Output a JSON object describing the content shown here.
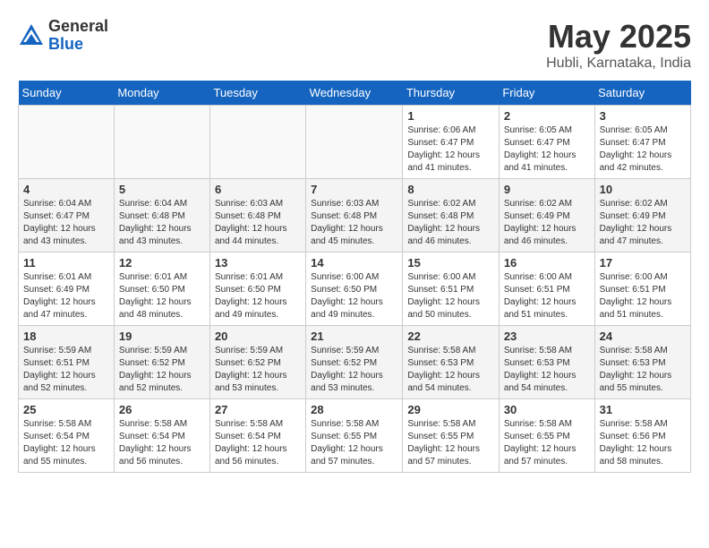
{
  "header": {
    "logo_general": "General",
    "logo_blue": "Blue",
    "title": "May 2025",
    "subtitle": "Hubli, Karnataka, India"
  },
  "days_of_week": [
    "Sunday",
    "Monday",
    "Tuesday",
    "Wednesday",
    "Thursday",
    "Friday",
    "Saturday"
  ],
  "weeks": [
    [
      {
        "day": "",
        "info": ""
      },
      {
        "day": "",
        "info": ""
      },
      {
        "day": "",
        "info": ""
      },
      {
        "day": "",
        "info": ""
      },
      {
        "day": "1",
        "info": "Sunrise: 6:06 AM\nSunset: 6:47 PM\nDaylight: 12 hours\nand 41 minutes."
      },
      {
        "day": "2",
        "info": "Sunrise: 6:05 AM\nSunset: 6:47 PM\nDaylight: 12 hours\nand 41 minutes."
      },
      {
        "day": "3",
        "info": "Sunrise: 6:05 AM\nSunset: 6:47 PM\nDaylight: 12 hours\nand 42 minutes."
      }
    ],
    [
      {
        "day": "4",
        "info": "Sunrise: 6:04 AM\nSunset: 6:47 PM\nDaylight: 12 hours\nand 43 minutes."
      },
      {
        "day": "5",
        "info": "Sunrise: 6:04 AM\nSunset: 6:48 PM\nDaylight: 12 hours\nand 43 minutes."
      },
      {
        "day": "6",
        "info": "Sunrise: 6:03 AM\nSunset: 6:48 PM\nDaylight: 12 hours\nand 44 minutes."
      },
      {
        "day": "7",
        "info": "Sunrise: 6:03 AM\nSunset: 6:48 PM\nDaylight: 12 hours\nand 45 minutes."
      },
      {
        "day": "8",
        "info": "Sunrise: 6:02 AM\nSunset: 6:48 PM\nDaylight: 12 hours\nand 46 minutes."
      },
      {
        "day": "9",
        "info": "Sunrise: 6:02 AM\nSunset: 6:49 PM\nDaylight: 12 hours\nand 46 minutes."
      },
      {
        "day": "10",
        "info": "Sunrise: 6:02 AM\nSunset: 6:49 PM\nDaylight: 12 hours\nand 47 minutes."
      }
    ],
    [
      {
        "day": "11",
        "info": "Sunrise: 6:01 AM\nSunset: 6:49 PM\nDaylight: 12 hours\nand 47 minutes."
      },
      {
        "day": "12",
        "info": "Sunrise: 6:01 AM\nSunset: 6:50 PM\nDaylight: 12 hours\nand 48 minutes."
      },
      {
        "day": "13",
        "info": "Sunrise: 6:01 AM\nSunset: 6:50 PM\nDaylight: 12 hours\nand 49 minutes."
      },
      {
        "day": "14",
        "info": "Sunrise: 6:00 AM\nSunset: 6:50 PM\nDaylight: 12 hours\nand 49 minutes."
      },
      {
        "day": "15",
        "info": "Sunrise: 6:00 AM\nSunset: 6:51 PM\nDaylight: 12 hours\nand 50 minutes."
      },
      {
        "day": "16",
        "info": "Sunrise: 6:00 AM\nSunset: 6:51 PM\nDaylight: 12 hours\nand 51 minutes."
      },
      {
        "day": "17",
        "info": "Sunrise: 6:00 AM\nSunset: 6:51 PM\nDaylight: 12 hours\nand 51 minutes."
      }
    ],
    [
      {
        "day": "18",
        "info": "Sunrise: 5:59 AM\nSunset: 6:51 PM\nDaylight: 12 hours\nand 52 minutes."
      },
      {
        "day": "19",
        "info": "Sunrise: 5:59 AM\nSunset: 6:52 PM\nDaylight: 12 hours\nand 52 minutes."
      },
      {
        "day": "20",
        "info": "Sunrise: 5:59 AM\nSunset: 6:52 PM\nDaylight: 12 hours\nand 53 minutes."
      },
      {
        "day": "21",
        "info": "Sunrise: 5:59 AM\nSunset: 6:52 PM\nDaylight: 12 hours\nand 53 minutes."
      },
      {
        "day": "22",
        "info": "Sunrise: 5:58 AM\nSunset: 6:53 PM\nDaylight: 12 hours\nand 54 minutes."
      },
      {
        "day": "23",
        "info": "Sunrise: 5:58 AM\nSunset: 6:53 PM\nDaylight: 12 hours\nand 54 minutes."
      },
      {
        "day": "24",
        "info": "Sunrise: 5:58 AM\nSunset: 6:53 PM\nDaylight: 12 hours\nand 55 minutes."
      }
    ],
    [
      {
        "day": "25",
        "info": "Sunrise: 5:58 AM\nSunset: 6:54 PM\nDaylight: 12 hours\nand 55 minutes."
      },
      {
        "day": "26",
        "info": "Sunrise: 5:58 AM\nSunset: 6:54 PM\nDaylight: 12 hours\nand 56 minutes."
      },
      {
        "day": "27",
        "info": "Sunrise: 5:58 AM\nSunset: 6:54 PM\nDaylight: 12 hours\nand 56 minutes."
      },
      {
        "day": "28",
        "info": "Sunrise: 5:58 AM\nSunset: 6:55 PM\nDaylight: 12 hours\nand 57 minutes."
      },
      {
        "day": "29",
        "info": "Sunrise: 5:58 AM\nSunset: 6:55 PM\nDaylight: 12 hours\nand 57 minutes."
      },
      {
        "day": "30",
        "info": "Sunrise: 5:58 AM\nSunset: 6:55 PM\nDaylight: 12 hours\nand 57 minutes."
      },
      {
        "day": "31",
        "info": "Sunrise: 5:58 AM\nSunset: 6:56 PM\nDaylight: 12 hours\nand 58 minutes."
      }
    ]
  ]
}
